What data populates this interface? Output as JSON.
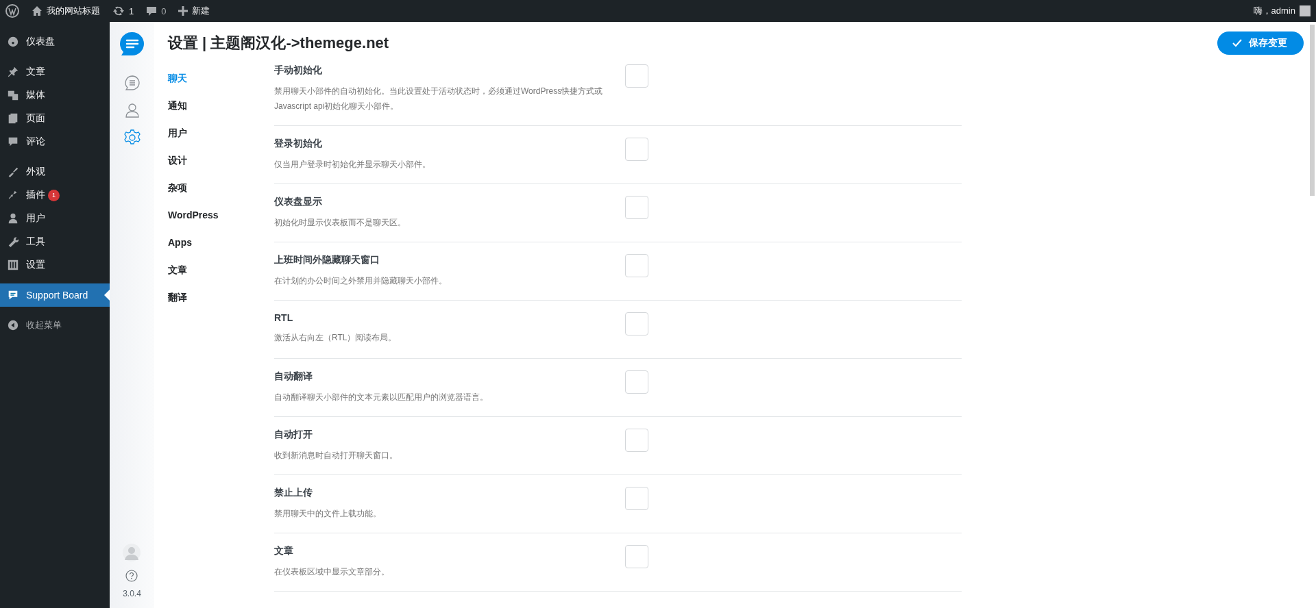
{
  "admin_bar": {
    "site_title": "我的网站标题",
    "updates": "1",
    "comments": "0",
    "new": "新建",
    "greeting": "嗨，admin"
  },
  "admin_menu": {
    "groups": [
      [
        {
          "label": "仪表盘",
          "selected": false
        }
      ],
      [
        {
          "label": "文章",
          "selected": false
        },
        {
          "label": "媒体",
          "selected": false
        },
        {
          "label": "页面",
          "selected": false
        },
        {
          "label": "评论",
          "selected": false
        }
      ],
      [
        {
          "label": "外观",
          "selected": false
        },
        {
          "label": "插件",
          "selected": false,
          "badge": "1"
        },
        {
          "label": "用户",
          "selected": false
        },
        {
          "label": "工具",
          "selected": false
        },
        {
          "label": "设置",
          "selected": false
        }
      ],
      [
        {
          "label": "Support Board",
          "selected": true
        }
      ]
    ],
    "collapse": "收起菜单"
  },
  "app_sidebar": {
    "nav": [
      {
        "selected": false
      },
      {
        "selected": false
      },
      {
        "selected": true
      }
    ],
    "version": "3.0.4"
  },
  "header": {
    "title": "设置 | 主题阁汉化->themege.net",
    "save_button": "保存变更"
  },
  "settings_nav": [
    {
      "label": "聊天",
      "selected": true
    },
    {
      "label": "通知",
      "selected": false
    },
    {
      "label": "用户",
      "selected": false
    },
    {
      "label": "设计",
      "selected": false
    },
    {
      "label": "杂项",
      "selected": false
    },
    {
      "label": "WordPress",
      "selected": false
    },
    {
      "label": "Apps",
      "selected": false
    },
    {
      "label": "文章",
      "selected": false
    },
    {
      "label": "翻译",
      "selected": false
    }
  ],
  "settings": [
    {
      "title": "手动初始化",
      "description": "禁用聊天小部件的自动初始化。当此设置处于活动状态时，必须通过WordPress快捷方式或Javascript api初始化聊天小部件。",
      "checked": false
    },
    {
      "title": "登录初始化",
      "description": "仅当用户登录时初始化并显示聊天小部件。",
      "checked": false
    },
    {
      "title": "仪表盘显示",
      "description": "初始化时显示仪表板而不是聊天区。",
      "checked": false
    },
    {
      "title": "上班时间外隐藏聊天窗口",
      "description": "在计划的办公时间之外禁用并隐藏聊天小部件。",
      "checked": false
    },
    {
      "title": "RTL",
      "description": "激活从右向左（RTL）阅读布局。",
      "checked": false
    },
    {
      "title": "自动翻译",
      "description": "自动翻译聊天小部件的文本元素以匹配用户的浏览器语言。",
      "checked": false
    },
    {
      "title": "自动打开",
      "description": "收到新消息时自动打开聊天窗口。",
      "checked": false
    },
    {
      "title": "禁止上传",
      "description": "禁用聊天中的文件上载功能。",
      "checked": false
    },
    {
      "title": "文章",
      "description": "在仪表板区域中显示文章部分。",
      "checked": false
    }
  ]
}
